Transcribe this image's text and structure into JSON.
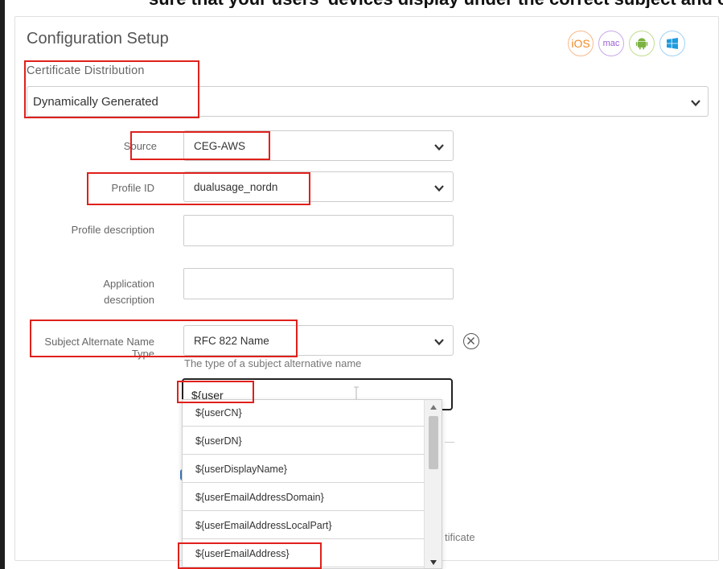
{
  "header_crop_text": "sure that your users' devices display under the correct subject and configuration settings",
  "panel": {
    "title": "Configuration Setup",
    "os_icons": [
      {
        "name": "ios-icon",
        "label": "iOS",
        "color": "#f08a24"
      },
      {
        "name": "mac-icon",
        "label": "mac",
        "color": "#9b5bd6"
      },
      {
        "name": "android-icon",
        "label": "",
        "color": "#7cb342"
      },
      {
        "name": "windows-icon",
        "label": "",
        "color": "#1e9be0"
      }
    ]
  },
  "certificate_distribution": {
    "label": "Certificate Distribution",
    "value": "Dynamically Generated"
  },
  "fields": {
    "source": {
      "label": "Source",
      "value": "CEG-AWS"
    },
    "profile_id": {
      "label": "Profile ID",
      "value": "dualusage_nordn"
    },
    "profile_description": {
      "label": "Profile description",
      "value": ""
    },
    "application_description": {
      "label_line1": "Application",
      "label_line2": "description",
      "value": ""
    },
    "subject_alt_name_type": {
      "label_line1": "Subject Alternate Name",
      "label_line2": "Type",
      "value": "RFC 822 Name",
      "hint": "The type of a subject alternative name"
    },
    "san_value": {
      "value": "${user"
    }
  },
  "autocomplete": {
    "items": [
      "${userCN}",
      "${userDN}",
      "${userDisplayName}",
      "${userEmailAddressDomain}",
      "${userEmailAddressLocalPart}",
      "${userEmailAddress}"
    ]
  },
  "partial_text": "tificate",
  "colors": {
    "highlight_red": "#e0201b",
    "border": "#cccccc"
  }
}
